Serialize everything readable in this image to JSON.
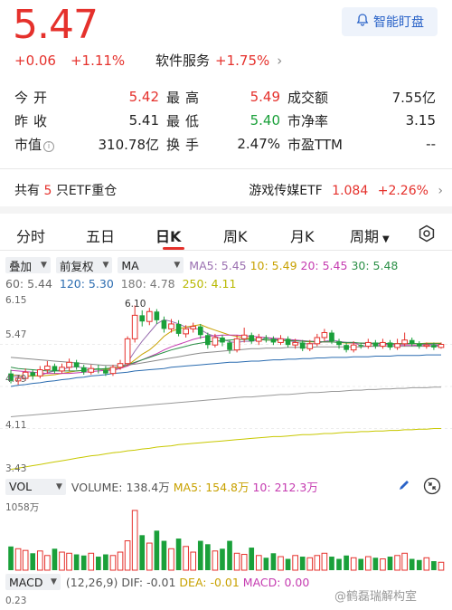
{
  "header": {
    "price": "5.47",
    "change": "+0.06",
    "change_pct": "+1.11%",
    "alert_label": "智能盯盘",
    "sector_name": "软件服务",
    "sector_change": "+1.75%"
  },
  "quote": {
    "rows": [
      {
        "l1": "今开",
        "v1": "5.42",
        "l2": "最高",
        "v2": "5.49",
        "l3": "成交额",
        "v3": "7.55亿"
      },
      {
        "l1": "昨收",
        "v1": "5.41",
        "l2": "最低",
        "v2": "5.40",
        "l3": "市净率",
        "v3": "3.15"
      },
      {
        "l1": "市值",
        "v1": "310.78亿",
        "l2": "换手",
        "v2": "2.47%",
        "l3": "市盈TTM",
        "v3": "--"
      }
    ]
  },
  "etf": {
    "prefix": "共有",
    "count": "5",
    "suffix": "只ETF重仓",
    "name": "游戏传媒ETF",
    "price": "1.084",
    "change": "+2.26%"
  },
  "tabs": [
    "分时",
    "五日",
    "日K",
    "周K",
    "月K",
    "周期"
  ],
  "active_tab": "日K",
  "indicators": {
    "overlay": "叠加",
    "adjust": "前复权",
    "ma": "MA",
    "ma5": "MA5: 5.45",
    "ma10": "10: 5.49",
    "ma20": "20: 5.45",
    "ma30": "30: 5.48",
    "ma60": "60: 5.44",
    "ma120": "120: 5.30",
    "ma180": "180: 4.78",
    "ma250": "250: 4.11"
  },
  "chart_data": {
    "type": "candlestick",
    "y_labels": [
      "6.15",
      "5.47",
      "4.79",
      "4.11",
      "3.43"
    ],
    "high_marker": "6.10",
    "ylim": [
      3.43,
      6.15
    ],
    "candles": [
      [
        5.0,
        4.88,
        5.06,
        4.84
      ],
      [
        4.88,
        4.92,
        4.98,
        4.82
      ],
      [
        4.92,
        5.02,
        5.08,
        4.88
      ],
      [
        5.02,
        4.96,
        5.06,
        4.9
      ],
      [
        4.96,
        5.06,
        5.12,
        4.92
      ],
      [
        5.06,
        5.12,
        5.2,
        5.0
      ],
      [
        5.12,
        5.04,
        5.16,
        5.0
      ],
      [
        5.04,
        5.1,
        5.16,
        5.0
      ],
      [
        5.1,
        5.18,
        5.24,
        5.04
      ],
      [
        5.18,
        5.1,
        5.22,
        5.06
      ],
      [
        5.1,
        5.02,
        5.14,
        4.98
      ],
      [
        5.02,
        5.08,
        5.14,
        4.98
      ],
      [
        5.08,
        5.06,
        5.14,
        5.0
      ],
      [
        5.06,
        5.0,
        5.12,
        4.96
      ],
      [
        5.0,
        5.1,
        5.14,
        4.96
      ],
      [
        5.1,
        5.16,
        5.22,
        5.06
      ],
      [
        5.16,
        5.56,
        5.6,
        5.12
      ],
      [
        5.56,
        5.94,
        6.1,
        5.5
      ],
      [
        5.94,
        5.84,
        6.02,
        5.76
      ],
      [
        5.84,
        6.0,
        6.06,
        5.78
      ],
      [
        6.0,
        5.86,
        6.04,
        5.8
      ],
      [
        5.86,
        5.72,
        5.92,
        5.66
      ],
      [
        5.72,
        5.8,
        5.88,
        5.66
      ],
      [
        5.8,
        5.64,
        5.86,
        5.6
      ],
      [
        5.64,
        5.72,
        5.78,
        5.58
      ],
      [
        5.72,
        5.76,
        5.82,
        5.66
      ],
      [
        5.76,
        5.62,
        5.8,
        5.56
      ],
      [
        5.62,
        5.46,
        5.66,
        5.4
      ],
      [
        5.46,
        5.58,
        5.64,
        5.42
      ],
      [
        5.58,
        5.5,
        5.62,
        5.44
      ],
      [
        5.5,
        5.38,
        5.54,
        5.32
      ],
      [
        5.38,
        5.56,
        5.62,
        5.34
      ],
      [
        5.56,
        5.62,
        5.74,
        5.5
      ],
      [
        5.62,
        5.52,
        5.66,
        5.48
      ],
      [
        5.52,
        5.58,
        5.64,
        5.46
      ],
      [
        5.58,
        5.56,
        5.62,
        5.5
      ],
      [
        5.56,
        5.5,
        5.6,
        5.46
      ],
      [
        5.5,
        5.56,
        5.62,
        5.46
      ],
      [
        5.56,
        5.46,
        5.6,
        5.42
      ],
      [
        5.46,
        5.5,
        5.56,
        5.4
      ],
      [
        5.5,
        5.4,
        5.54,
        5.36
      ],
      [
        5.4,
        5.48,
        5.54,
        5.36
      ],
      [
        5.48,
        5.58,
        5.64,
        5.44
      ],
      [
        5.58,
        5.66,
        5.72,
        5.52
      ],
      [
        5.66,
        5.52,
        5.7,
        5.48
      ],
      [
        5.52,
        5.46,
        5.56,
        5.4
      ],
      [
        5.46,
        5.38,
        5.5,
        5.34
      ],
      [
        5.38,
        5.46,
        5.52,
        5.34
      ],
      [
        5.46,
        5.44,
        5.5,
        5.4
      ],
      [
        5.44,
        5.5,
        5.56,
        5.4
      ],
      [
        5.5,
        5.44,
        5.54,
        5.4
      ],
      [
        5.44,
        5.5,
        5.56,
        5.4
      ],
      [
        5.5,
        5.42,
        5.54,
        5.38
      ],
      [
        5.42,
        5.48,
        5.56,
        5.38
      ],
      [
        5.48,
        5.54,
        5.66,
        5.44
      ],
      [
        5.54,
        5.48,
        5.58,
        5.44
      ],
      [
        5.48,
        5.44,
        5.52,
        5.4
      ],
      [
        5.44,
        5.46,
        5.5,
        5.4
      ],
      [
        5.46,
        5.42,
        5.5,
        5.38
      ],
      [
        5.42,
        5.47,
        5.5,
        5.4
      ]
    ],
    "ma_series": [
      {
        "name": "MA5",
        "color": "#9a6fb0",
        "values": [
          4.96,
          4.94,
          4.95,
          4.96,
          4.97,
          5.01,
          5.04,
          5.06,
          5.1,
          5.11,
          5.09,
          5.08,
          5.07,
          5.05,
          5.05,
          5.08,
          5.18,
          5.36,
          5.52,
          5.66,
          5.8,
          5.87,
          5.84,
          5.8,
          5.75,
          5.73,
          5.71,
          5.64,
          5.6,
          5.56,
          5.51,
          5.5,
          5.52,
          5.52,
          5.54,
          5.57,
          5.56,
          5.54,
          5.53,
          5.51,
          5.48,
          5.48,
          5.48,
          5.52,
          5.54,
          5.52,
          5.5,
          5.5,
          5.45,
          5.44,
          5.44,
          5.47,
          5.46,
          5.47,
          5.48,
          5.49,
          5.47,
          5.47,
          5.47,
          5.45
        ]
      },
      {
        "name": "MA10",
        "color": "#c8a100",
        "values": [
          4.98,
          4.97,
          4.96,
          4.96,
          4.96,
          4.97,
          4.98,
          5.0,
          5.02,
          5.04,
          5.05,
          5.06,
          5.07,
          5.07,
          5.07,
          5.09,
          5.13,
          5.22,
          5.31,
          5.38,
          5.48,
          5.6,
          5.68,
          5.72,
          5.75,
          5.77,
          5.79,
          5.74,
          5.7,
          5.66,
          5.62,
          5.6,
          5.58,
          5.56,
          5.55,
          5.54,
          5.54,
          5.53,
          5.53,
          5.53,
          5.52,
          5.51,
          5.51,
          5.51,
          5.51,
          5.5,
          5.49,
          5.49,
          5.49,
          5.48,
          5.48,
          5.48,
          5.48,
          5.48,
          5.48,
          5.48,
          5.48,
          5.49,
          5.49,
          5.49
        ]
      },
      {
        "name": "MA20",
        "color": "#c53bb0",
        "values": [
          5.05,
          5.04,
          5.03,
          5.02,
          5.01,
          5.0,
          5.0,
          5.0,
          5.0,
          5.01,
          5.02,
          5.03,
          5.04,
          5.05,
          5.06,
          5.08,
          5.12,
          5.17,
          5.22,
          5.27,
          5.32,
          5.38,
          5.43,
          5.47,
          5.51,
          5.55,
          5.58,
          5.6,
          5.61,
          5.62,
          5.62,
          5.62,
          5.61,
          5.6,
          5.59,
          5.58,
          5.57,
          5.56,
          5.55,
          5.54,
          5.53,
          5.52,
          5.52,
          5.51,
          5.51,
          5.5,
          5.5,
          5.49,
          5.49,
          5.48,
          5.48,
          5.47,
          5.47,
          5.46,
          5.46,
          5.46,
          5.45,
          5.45,
          5.45,
          5.45
        ]
      },
      {
        "name": "MA30",
        "color": "#2a8f46",
        "values": [
          5.1,
          5.08,
          5.07,
          5.06,
          5.05,
          5.04,
          5.04,
          5.04,
          5.04,
          5.04,
          5.05,
          5.06,
          5.07,
          5.08,
          5.09,
          5.11,
          5.14,
          5.18,
          5.22,
          5.26,
          5.3,
          5.34,
          5.38,
          5.41,
          5.44,
          5.47,
          5.49,
          5.51,
          5.52,
          5.53,
          5.54,
          5.55,
          5.55,
          5.55,
          5.55,
          5.54,
          5.54,
          5.54,
          5.53,
          5.53,
          5.52,
          5.52,
          5.51,
          5.51,
          5.51,
          5.5,
          5.5,
          5.5,
          5.49,
          5.49,
          5.49,
          5.49,
          5.48,
          5.48,
          5.48,
          5.48,
          5.48,
          5.48,
          5.48,
          5.48
        ]
      },
      {
        "name": "MA60",
        "color": "#8a8a8a",
        "values": [
          5.26,
          5.25,
          5.24,
          5.23,
          5.22,
          5.21,
          5.2,
          5.19,
          5.18,
          5.17,
          5.16,
          5.15,
          5.14,
          5.13,
          5.13,
          5.13,
          5.14,
          5.15,
          5.17,
          5.19,
          5.21,
          5.23,
          5.25,
          5.27,
          5.29,
          5.31,
          5.33,
          5.34,
          5.35,
          5.36,
          5.37,
          5.38,
          5.39,
          5.4,
          5.4,
          5.41,
          5.41,
          5.41,
          5.42,
          5.42,
          5.42,
          5.42,
          5.43,
          5.43,
          5.43,
          5.43,
          5.43,
          5.43,
          5.43,
          5.44,
          5.44,
          5.44,
          5.44,
          5.44,
          5.44,
          5.44,
          5.44,
          5.44,
          5.44,
          5.44
        ]
      },
      {
        "name": "MA120",
        "color": "#2b6cb0",
        "values": [
          4.79,
          4.81,
          4.82,
          4.84,
          4.85,
          4.87,
          4.88,
          4.9,
          4.91,
          4.93,
          4.94,
          4.96,
          4.97,
          4.98,
          5.0,
          5.01,
          5.02,
          5.04,
          5.05,
          5.06,
          5.07,
          5.08,
          5.1,
          5.11,
          5.12,
          5.13,
          5.14,
          5.15,
          5.16,
          5.17,
          5.18,
          5.18,
          5.19,
          5.2,
          5.2,
          5.21,
          5.22,
          5.22,
          5.23,
          5.23,
          5.24,
          5.24,
          5.25,
          5.25,
          5.26,
          5.26,
          5.26,
          5.27,
          5.27,
          5.27,
          5.28,
          5.28,
          5.28,
          5.29,
          5.29,
          5.29,
          5.29,
          5.3,
          5.3,
          5.3
        ]
      },
      {
        "name": "MA180",
        "color": "#999999",
        "values": [
          4.3,
          4.31,
          4.32,
          4.33,
          4.34,
          4.35,
          4.36,
          4.37,
          4.38,
          4.39,
          4.4,
          4.41,
          4.42,
          4.43,
          4.44,
          4.45,
          4.46,
          4.47,
          4.48,
          4.49,
          4.5,
          4.51,
          4.52,
          4.53,
          4.54,
          4.55,
          4.56,
          4.57,
          4.58,
          4.59,
          4.6,
          4.61,
          4.62,
          4.62,
          4.63,
          4.64,
          4.65,
          4.66,
          4.66,
          4.67,
          4.68,
          4.69,
          4.69,
          4.7,
          4.71,
          4.71,
          4.72,
          4.73,
          4.73,
          4.74,
          4.74,
          4.75,
          4.75,
          4.76,
          4.76,
          4.77,
          4.77,
          4.77,
          4.78,
          4.78
        ]
      },
      {
        "name": "MA250",
        "color": "#c8c800",
        "values": [
          3.45,
          3.47,
          3.49,
          3.51,
          3.53,
          3.55,
          3.57,
          3.59,
          3.61,
          3.63,
          3.65,
          3.67,
          3.68,
          3.7,
          3.72,
          3.73,
          3.75,
          3.76,
          3.78,
          3.79,
          3.81,
          3.82,
          3.83,
          3.85,
          3.86,
          3.87,
          3.88,
          3.89,
          3.9,
          3.91,
          3.92,
          3.93,
          3.94,
          3.95,
          3.96,
          3.97,
          3.98,
          3.98,
          3.99,
          4.0,
          4.01,
          4.01,
          4.02,
          4.03,
          4.03,
          4.04,
          4.05,
          4.05,
          4.06,
          4.06,
          4.07,
          4.07,
          4.08,
          4.08,
          4.09,
          4.09,
          4.1,
          4.1,
          4.11,
          4.11
        ]
      }
    ]
  },
  "volume": {
    "label": "VOL",
    "text": "VOLUME: 138.4万",
    "ma5": "MA5: 154.8万",
    "ma10": "10: 212.3万",
    "ymax_label": "1058万",
    "values": [
      420,
      380,
      350,
      300,
      340,
      260,
      380,
      320,
      300,
      280,
      260,
      300,
      240,
      280,
      260,
      320,
      520,
      1058,
      620,
      480,
      700,
      520,
      380,
      560,
      420,
      320,
      520,
      460,
      340,
      380,
      520,
      300,
      280,
      400,
      260,
      220,
      300,
      240,
      200,
      260,
      240,
      220,
      260,
      300,
      240,
      200,
      260,
      220,
      200,
      240,
      220,
      200,
      240,
      260,
      300,
      200,
      180,
      220,
      160,
      140
    ]
  },
  "macd": {
    "label": "MACD",
    "params": "(12,26,9)",
    "dif": "DIF: -0.01",
    "dea": "DEA: -0.01",
    "macd": "MACD: 0.00",
    "y_label": "0.23"
  },
  "watermark": "@鹤磊瑞解构室"
}
